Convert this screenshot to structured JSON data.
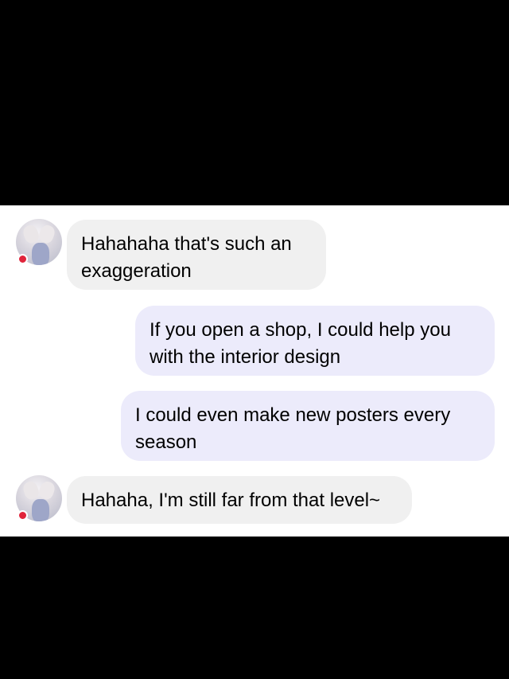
{
  "colors": {
    "frame": "#000000",
    "panel_background": "#ffffff",
    "incoming_bubble": "#f0f0f0",
    "outgoing_bubble": "#ecebfb",
    "online_dot": "#e0243b"
  },
  "messages": [
    {
      "sender": "contact",
      "text": "Hahahaha that's such an exaggeration"
    },
    {
      "sender": "me",
      "text": "If you open a shop, I could help you with the interior design"
    },
    {
      "sender": "me",
      "text": "I could even make new posters every season"
    },
    {
      "sender": "contact",
      "text": "Hahaha, I'm still far from that level~"
    }
  ]
}
